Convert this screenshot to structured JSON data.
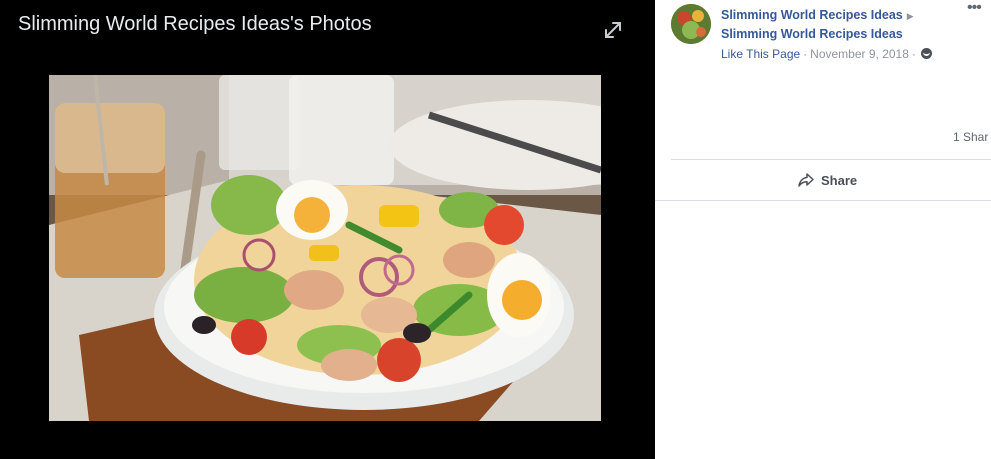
{
  "viewer": {
    "title": "Slimming World Recipes Ideas's Photos",
    "expand_icon": "expand-icon",
    "photo_subject": "salad-photo"
  },
  "post": {
    "page_name_primary": "Slimming World Recipes Ideas",
    "arrow_glyph": "▶",
    "page_name_secondary": "Slimming World Recipes Ideas",
    "like_page_label": "Like This Page",
    "separator": "·",
    "date": "November 9, 2018",
    "audience_icon": "globe-icon",
    "more_label": "•••"
  },
  "engagement": {
    "share_count": "1 Shar",
    "share_label": "Share",
    "share_icon": "share-arrow-icon"
  },
  "colors": {
    "link_blue": "#365899",
    "viewer_bg": "#000000",
    "meta_gray": "#90949c",
    "divider": "#dadde1"
  }
}
